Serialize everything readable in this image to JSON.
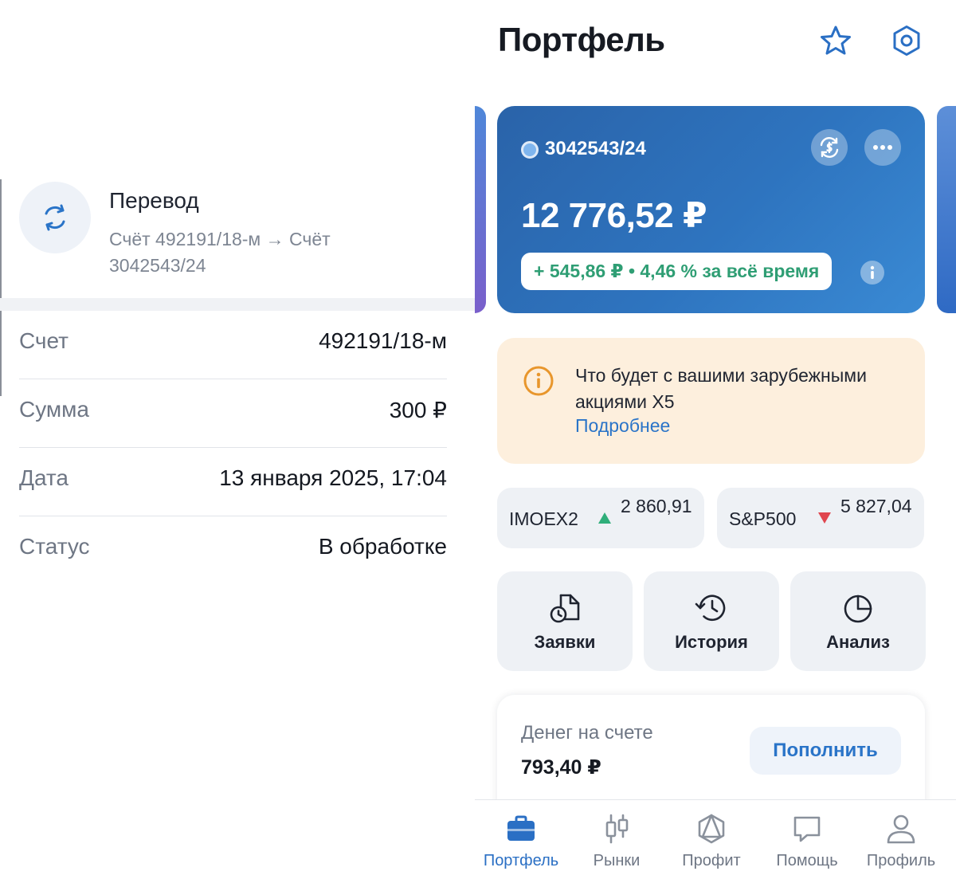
{
  "transfer": {
    "title": "Перевод",
    "subtitle": "Счёт 492191/18-м → Счёт 3042543/24",
    "details": [
      {
        "label": "Счет",
        "value": "492191/18-м"
      },
      {
        "label": "Сумма",
        "value": "300 ₽"
      },
      {
        "label": "Дата",
        "value": "13 января 2025, 17:04"
      },
      {
        "label": "Статус",
        "value": "В обработке"
      }
    ]
  },
  "portfolio": {
    "title": "Портфель",
    "account": {
      "number": "3042543/24",
      "balance": "12 776,52 ₽",
      "gain": "+ 545,86 ₽ • 4,46 % за всё время"
    },
    "notice": {
      "text": "Что будет с вашими зарубежными акциями X5",
      "link": "Подробнее"
    },
    "indices": [
      {
        "name": "IMOEX2",
        "value": "2 860,91",
        "direction": "up"
      },
      {
        "name": "S&P500",
        "value": "5 827,04",
        "direction": "down"
      }
    ],
    "actions": [
      {
        "label": "Заявки"
      },
      {
        "label": "История"
      },
      {
        "label": "Анализ"
      }
    ],
    "cash": {
      "label": "Денег на счете",
      "value": "793,40 ₽",
      "button": "Пополнить"
    }
  },
  "nav": [
    {
      "label": "Портфель",
      "icon": "briefcase-icon",
      "active": true
    },
    {
      "label": "Рынки",
      "icon": "candlestick-icon",
      "active": false
    },
    {
      "label": "Профит",
      "icon": "hexagon-icon",
      "active": false
    },
    {
      "label": "Помощь",
      "icon": "chat-icon",
      "active": false
    },
    {
      "label": "Профиль",
      "icon": "person-icon",
      "active": false
    }
  ],
  "colors": {
    "accent": "#2a6fc4",
    "card_blue": "#2e74bf",
    "gain_green": "#2f9e74",
    "notice_bg": "#fdefdd",
    "notice_icon": "#e8962c",
    "up": "#2fae7a",
    "down": "#e0464f"
  }
}
